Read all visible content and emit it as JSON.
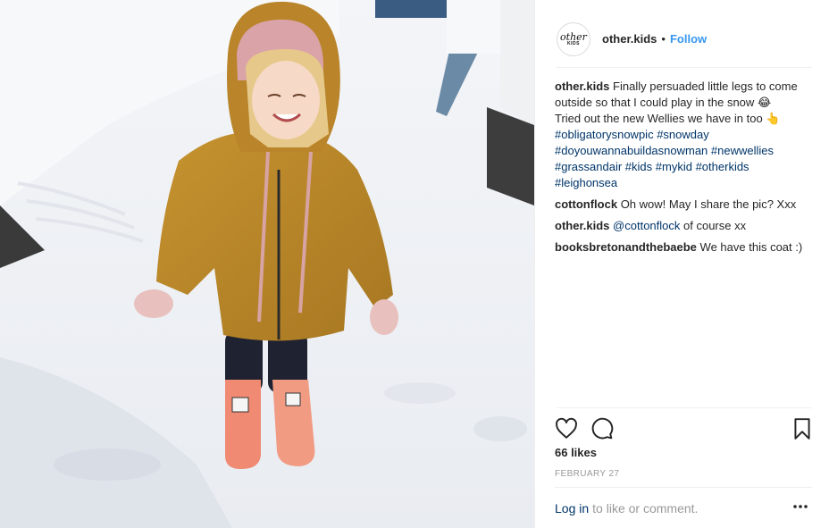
{
  "post": {
    "photo_alt": "",
    "author": {
      "username": "other.kids",
      "logo_text": "other",
      "logo_sub": "KIDS",
      "follow_label": "Follow",
      "separator": "•"
    },
    "caption": {
      "user": "other.kids",
      "text_1": "Finally persuaded little legs to come outside so that I could play in the snow",
      "emoji_1": "😂",
      "text_2": "Tried out the new Wellies we have in too",
      "emoji_2": "👆",
      "hashtags": [
        "#obligatorysnowpic",
        "#snowday",
        "#doyouwannabuildasnowman",
        "#newwellies",
        "#grassandair",
        "#kids",
        "#mykid",
        "#otherkids",
        "#leighonsea"
      ]
    },
    "comments": [
      {
        "user": "cottonflock",
        "text": "Oh wow! May I share the pic? Xxx"
      },
      {
        "user": "other.kids",
        "mention": "@cottonflock",
        "text": "of course xx"
      },
      {
        "user": "booksbretonandthebaebe",
        "text": "We have this coat :)"
      }
    ],
    "likes": "66 likes",
    "date": "FEBRUARY 27",
    "login_link": "Log in",
    "login_rest": "to like or comment.",
    "icons": {
      "like": "heart-icon",
      "comment": "speech-bubble-icon",
      "save": "bookmark-icon",
      "more": "more-options-icon"
    },
    "colors": {
      "link_blue": "#3897f0",
      "hashtag": "#003569",
      "muted": "#999999",
      "coat": "#b8862a",
      "boots": "#f08a72"
    }
  }
}
